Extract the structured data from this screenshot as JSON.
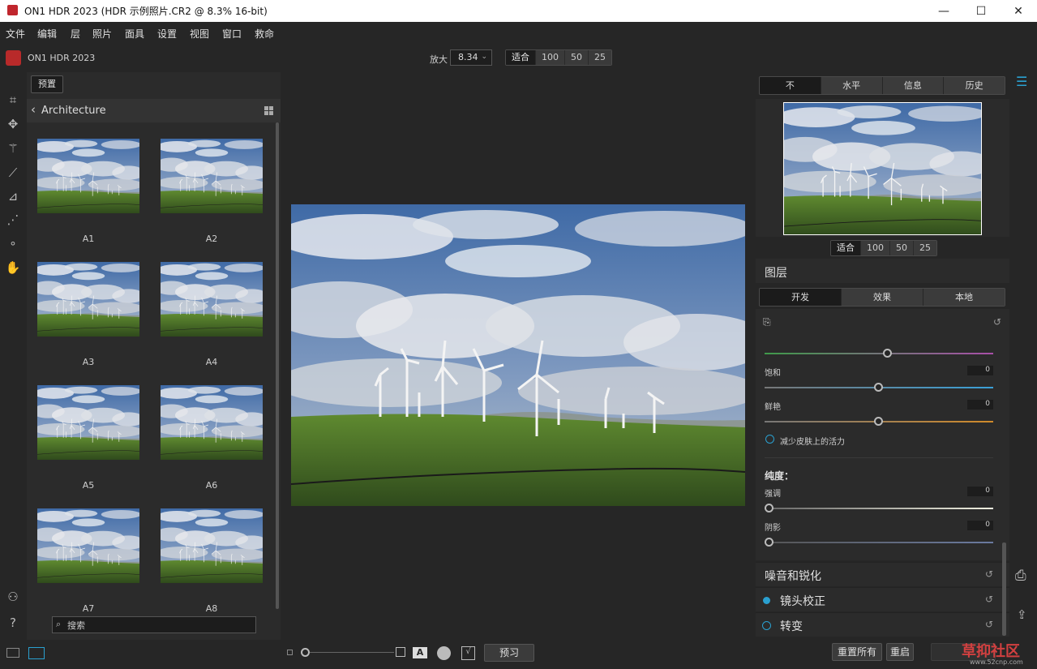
{
  "window": {
    "title": "ON1 HDR 2023 (HDR 示例照片.CR2 @ 8.3% 16-bit)",
    "minimize": "—",
    "maximize": "☐",
    "close": "✕"
  },
  "menu": [
    "文件",
    "编辑",
    "层",
    "照片",
    "面具",
    "设置",
    "视图",
    "窗口",
    "救命"
  ],
  "toolbar": {
    "brand": "ON1 HDR 2023",
    "zoom_label": "放大",
    "zoom_value": "8.34",
    "zoom_presets": [
      "适合",
      "100",
      "50",
      "25"
    ]
  },
  "browser": {
    "preset_button": "预置",
    "folder": "Architecture",
    "thumbnails": [
      "A1",
      "A2",
      "A3",
      "A4",
      "A5",
      "A6",
      "A7",
      "A8"
    ],
    "search_placeholder": "搜索"
  },
  "right_panel": {
    "tabs": [
      "不",
      "水平",
      "信息",
      "历史"
    ],
    "nav_zoom": [
      "适合",
      "100",
      "50",
      "25"
    ],
    "layers_title": "图层",
    "layer_tabs": [
      "开发",
      "效果",
      "本地"
    ],
    "sliders": {
      "saturation_label": "饱和",
      "saturation_value": "0",
      "vibrance_label": "鲜艳",
      "vibrance_value": "0",
      "protect_skin": "减少皮肤上的活力",
      "purity_title": "纯度：",
      "highlights_label": "强调",
      "highlights_value": "0",
      "shadows_label": "阴影",
      "shadows_value": "0"
    },
    "sections": {
      "noise": "噪音和锐化",
      "lens": "镜头校正",
      "transform": "转变"
    }
  },
  "bottom": {
    "preview_button": "预习",
    "reset_all": "重置所有",
    "restart": "重启",
    "watermark": "草抑社区",
    "watermark_url": "www.52cnp.com"
  },
  "colors": {
    "accent": "#2aa0d0",
    "bg": "#262626",
    "panel": "#2b2b2b"
  }
}
